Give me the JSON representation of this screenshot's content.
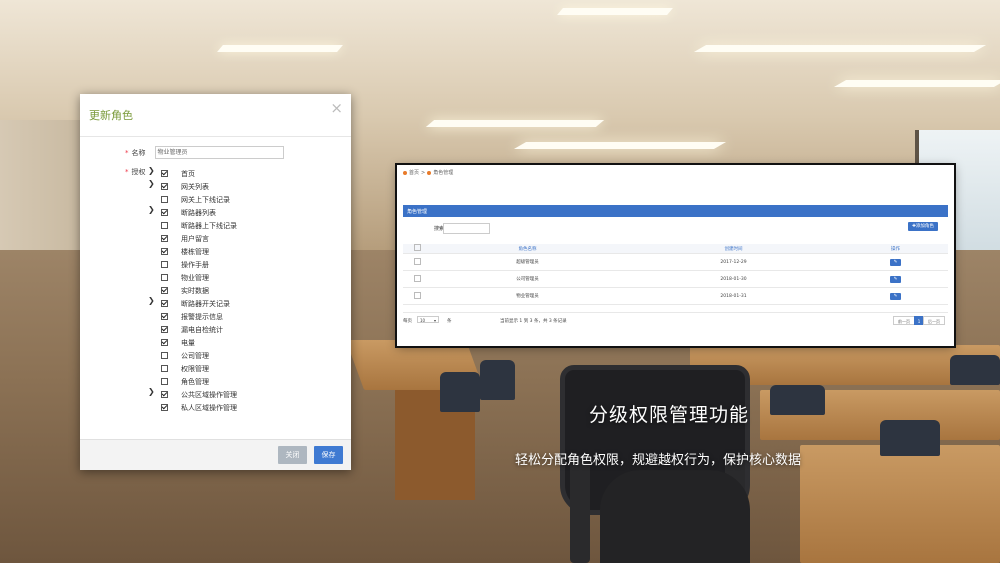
{
  "modal": {
    "title": "更新角色",
    "close_symbol": "×",
    "name_label": "名称",
    "name_value": "物业管理员",
    "perm_label": "授权",
    "tree": [
      {
        "label": "首页",
        "expandable": true,
        "checked": true
      },
      {
        "label": "网关列表",
        "expandable": true,
        "checked": true
      },
      {
        "label": "网关上下线记录",
        "expandable": false,
        "checked": false
      },
      {
        "label": "断路器列表",
        "expandable": true,
        "checked": true
      },
      {
        "label": "断路器上下线记录",
        "expandable": false,
        "checked": false
      },
      {
        "label": "用户留言",
        "expandable": false,
        "checked": true
      },
      {
        "label": "楼栋管理",
        "expandable": false,
        "checked": true
      },
      {
        "label": "操作手册",
        "expandable": false,
        "checked": false
      },
      {
        "label": "物业管理",
        "expandable": false,
        "checked": false
      },
      {
        "label": "实时数据",
        "expandable": false,
        "checked": true
      },
      {
        "label": "断路器开关记录",
        "expandable": true,
        "checked": true
      },
      {
        "label": "报警提示信息",
        "expandable": false,
        "checked": true
      },
      {
        "label": "漏电自检统计",
        "expandable": false,
        "checked": true
      },
      {
        "label": "电量",
        "expandable": false,
        "checked": true
      },
      {
        "label": "公司管理",
        "expandable": false,
        "checked": false
      },
      {
        "label": "权限管理",
        "expandable": false,
        "checked": false
      },
      {
        "label": "角色管理",
        "expandable": false,
        "checked": false
      },
      {
        "label": "公共区域操作管理",
        "expandable": true,
        "checked": true
      },
      {
        "label": "私人区域操作管理",
        "expandable": false,
        "checked": true
      }
    ],
    "close_label": "关闭",
    "save_label": "保存"
  },
  "panel": {
    "breadcrumb": [
      "首页",
      "角色管理"
    ],
    "breadcrumb_sep": ">",
    "header_title": "角色管理",
    "search_label": "搜索",
    "add_label": "✚添加角色",
    "columns": [
      "角色名称",
      "创建时间",
      "操作"
    ],
    "rows": [
      {
        "name": "超级管理员",
        "created": "2017-12-29"
      },
      {
        "name": "公司管理员",
        "created": "2018-01-30"
      },
      {
        "name": "物业管理员",
        "created": "2018-01-31"
      }
    ],
    "edit_symbol": "✎",
    "pager": {
      "show_label": "每页",
      "page_size": "10",
      "unit": "条",
      "info": "当前显示 1 到 3 条，共 3 条记录",
      "prev": "前一页",
      "current": "1",
      "next": "后一页"
    }
  },
  "caption": {
    "title": "分级权限管理功能",
    "subtitle": "轻松分配角色权限，规避越权行为，保护核心数据"
  }
}
